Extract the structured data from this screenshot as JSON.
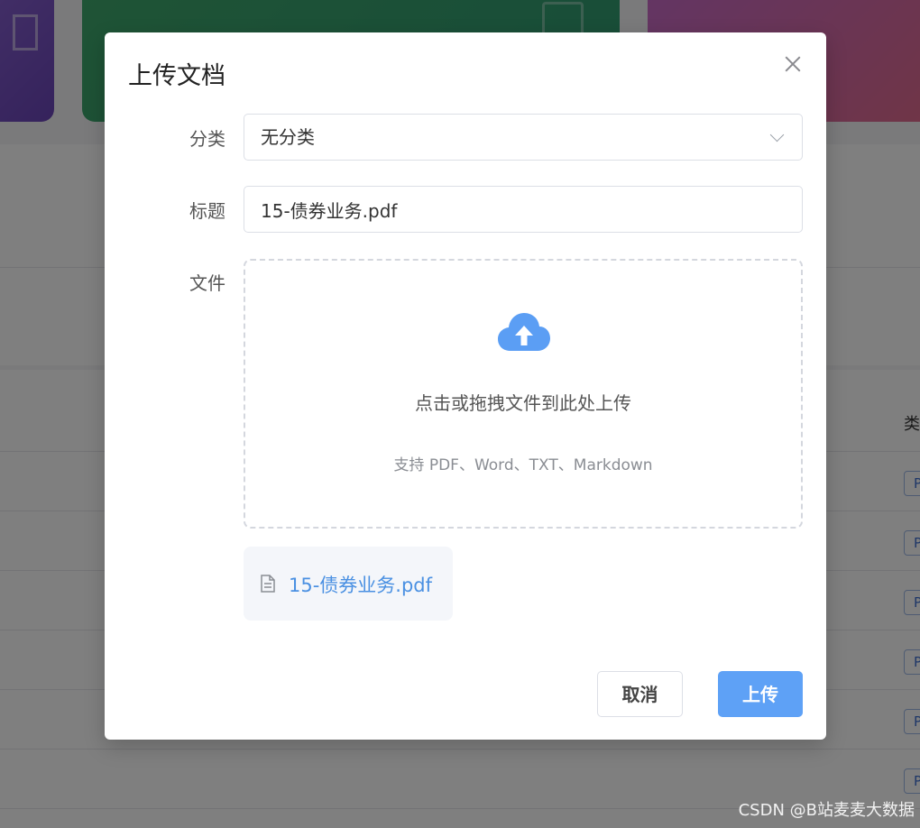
{
  "dialog": {
    "title": "上传文档",
    "close_icon": "close-icon",
    "category_label": "分类",
    "category_value": "无分类",
    "title_label": "标题",
    "title_value": "15-债券业务.pdf",
    "file_label": "文件",
    "upload_area": {
      "icon": "cloud-upload-icon",
      "text": "点击或拖拽文件到此处上传",
      "hint": "支持 PDF、Word、TXT、Markdown"
    },
    "selected_file": {
      "icon": "document-icon",
      "name": "15-债券业务.pdf"
    },
    "cancel_label": "取消",
    "upload_label": "上传"
  },
  "background": {
    "table_header_partial": "类",
    "tag_partial": "P"
  },
  "watermark": "CSDN @B站麦麦大数据",
  "colors": {
    "primary": "#5ea1f6",
    "link": "#4a90e2",
    "card_purple": "#7b55c6",
    "card_green": "#37a06f",
    "card_pink": "#d46aa8"
  }
}
